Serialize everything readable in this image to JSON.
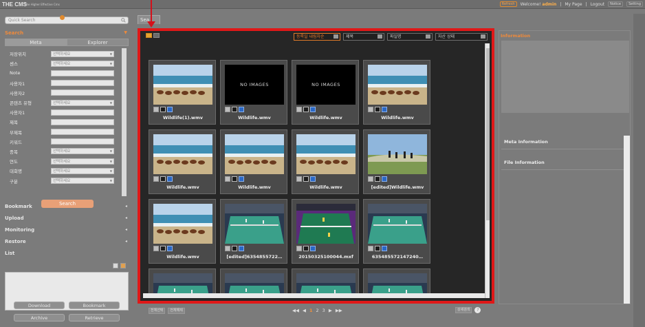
{
  "app": {
    "logo": "THE CMS",
    "tagline": "The Higher Effective Cms"
  },
  "topbar": {
    "refresh": "Refresh",
    "welcome": "Welcome!",
    "user": "admin",
    "mypage": "My Page",
    "logout": "Logout",
    "notice": "Notice",
    "setting": "Setting"
  },
  "sidebar": {
    "quick_search_placeholder": "Quick Search",
    "search_title": "Search",
    "tabs": [
      "Meta",
      "Explorer"
    ],
    "fields": [
      {
        "label": "저장위치",
        "type": "select",
        "value": "선택하세요"
      },
      {
        "label": "센스",
        "type": "select",
        "value": "선택하세요"
      },
      {
        "label": "Note",
        "type": "input",
        "value": ""
      },
      {
        "label": "사용자1",
        "type": "input",
        "value": ""
      },
      {
        "label": "사용자2",
        "type": "input",
        "value": ""
      },
      {
        "label": "콘텐츠 유형",
        "type": "select",
        "value": "선택하세요"
      },
      {
        "label": "사용자1",
        "type": "input",
        "value": ""
      },
      {
        "label": "제목",
        "type": "input",
        "value": ""
      },
      {
        "label": "부제목",
        "type": "input",
        "value": ""
      },
      {
        "label": "키워드",
        "type": "input",
        "value": ""
      },
      {
        "label": "종목",
        "type": "select",
        "value": "선택하세요"
      },
      {
        "label": "연도",
        "type": "select",
        "value": "선택하세요"
      },
      {
        "label": "대회명",
        "type": "select",
        "value": "선택하세요"
      },
      {
        "label": "구분",
        "type": "select",
        "value": "선택하세요"
      }
    ],
    "search_button": "Search",
    "bookmark": "Bookmark",
    "upload": "Upload",
    "monitoring": "Monitoring",
    "restore": "Restore",
    "list": "List",
    "buttons": {
      "download": "Download",
      "bookmark": "Bookmark",
      "archive": "Archive",
      "retrieve": "Retrieve"
    }
  },
  "main": {
    "tab_label": "Sea",
    "filters": [
      "등록일 내림차순",
      "제목",
      "파일명",
      "자산 상태"
    ],
    "cards": [
      {
        "title": "Wildlife(1).wmv",
        "thumb": "horses"
      },
      {
        "title": "Wildlife.wmv",
        "thumb": "none",
        "noimg": "NO IMAGES"
      },
      {
        "title": "Wildlife.wmv",
        "thumb": "none",
        "noimg": "NO IMAGES"
      },
      {
        "title": "Wildlife.wmv",
        "thumb": "horses"
      },
      {
        "title": "Wildlife.wmv",
        "thumb": "horses"
      },
      {
        "title": "Wildlife.wmv",
        "thumb": "horses"
      },
      {
        "title": "Wildlife.wmv",
        "thumb": "horses"
      },
      {
        "title": "[edited]Wildlife.wmv",
        "thumb": "birds"
      },
      {
        "title": "Wildlife.wmv",
        "thumb": "horses"
      },
      {
        "title": "[edited]6354855722…",
        "thumb": "court"
      },
      {
        "title": "20150325100044.mxf",
        "thumb": "court2"
      },
      {
        "title": "635485572147240…",
        "thumb": "court"
      },
      {
        "title": "",
        "thumb": "court"
      },
      {
        "title": "",
        "thumb": "court"
      },
      {
        "title": "",
        "thumb": "court"
      },
      {
        "title": "",
        "thumb": "court"
      }
    ],
    "bottom_buttons": [
      "전체선택",
      "전체해제"
    ],
    "pager": {
      "prev2": "◀◀",
      "prev": "◀",
      "pages": [
        "1",
        "2",
        "3"
      ],
      "current": "1",
      "next": "▶",
      "next2": "▶▶"
    },
    "right_button": "상세검색",
    "help": "?"
  },
  "info": {
    "title": "Information",
    "meta": "Meta Information",
    "file": "File Information"
  }
}
